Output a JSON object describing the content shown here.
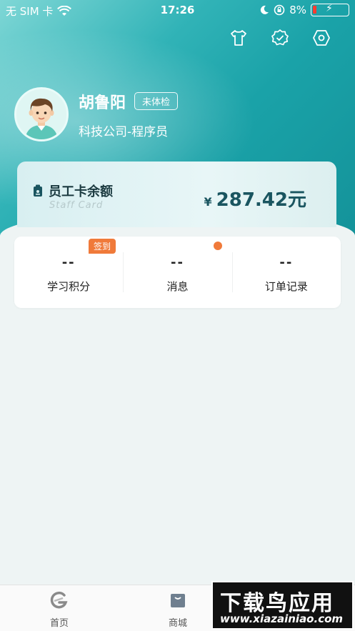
{
  "status_bar": {
    "carrier": "无 SIM 卡",
    "time": "17:26",
    "battery": "8%",
    "icons": [
      "wifi-icon",
      "moon-icon",
      "rotation-lock-icon",
      "battery-icon"
    ]
  },
  "header": {
    "icons": [
      "shirt-icon",
      "verified-icon",
      "settings-icon"
    ]
  },
  "profile": {
    "name": "胡鲁阳",
    "status_badge": "未体检",
    "company": "科技公司-程序员"
  },
  "card": {
    "title": "员工卡余额",
    "subtitle": "Staff Card",
    "currency": "¥",
    "amount": "287.42元"
  },
  "stats": [
    {
      "value": "--",
      "label": "学习积分",
      "badge": "签到"
    },
    {
      "value": "--",
      "label": "消息"
    },
    {
      "value": "--",
      "label": "订单记录"
    }
  ],
  "tabbar": {
    "tabs": [
      {
        "label": "首页",
        "icon": "home-logo-icon"
      },
      {
        "label": "商城",
        "icon": "shop-bag-icon"
      }
    ]
  },
  "watermark": {
    "top": "下载鸟应用",
    "bottom": "www.xiazainiao.com"
  },
  "colors": {
    "accent": "#1aa2a8",
    "badge": "#f07a3a",
    "battery_low": "#ff3b30"
  }
}
